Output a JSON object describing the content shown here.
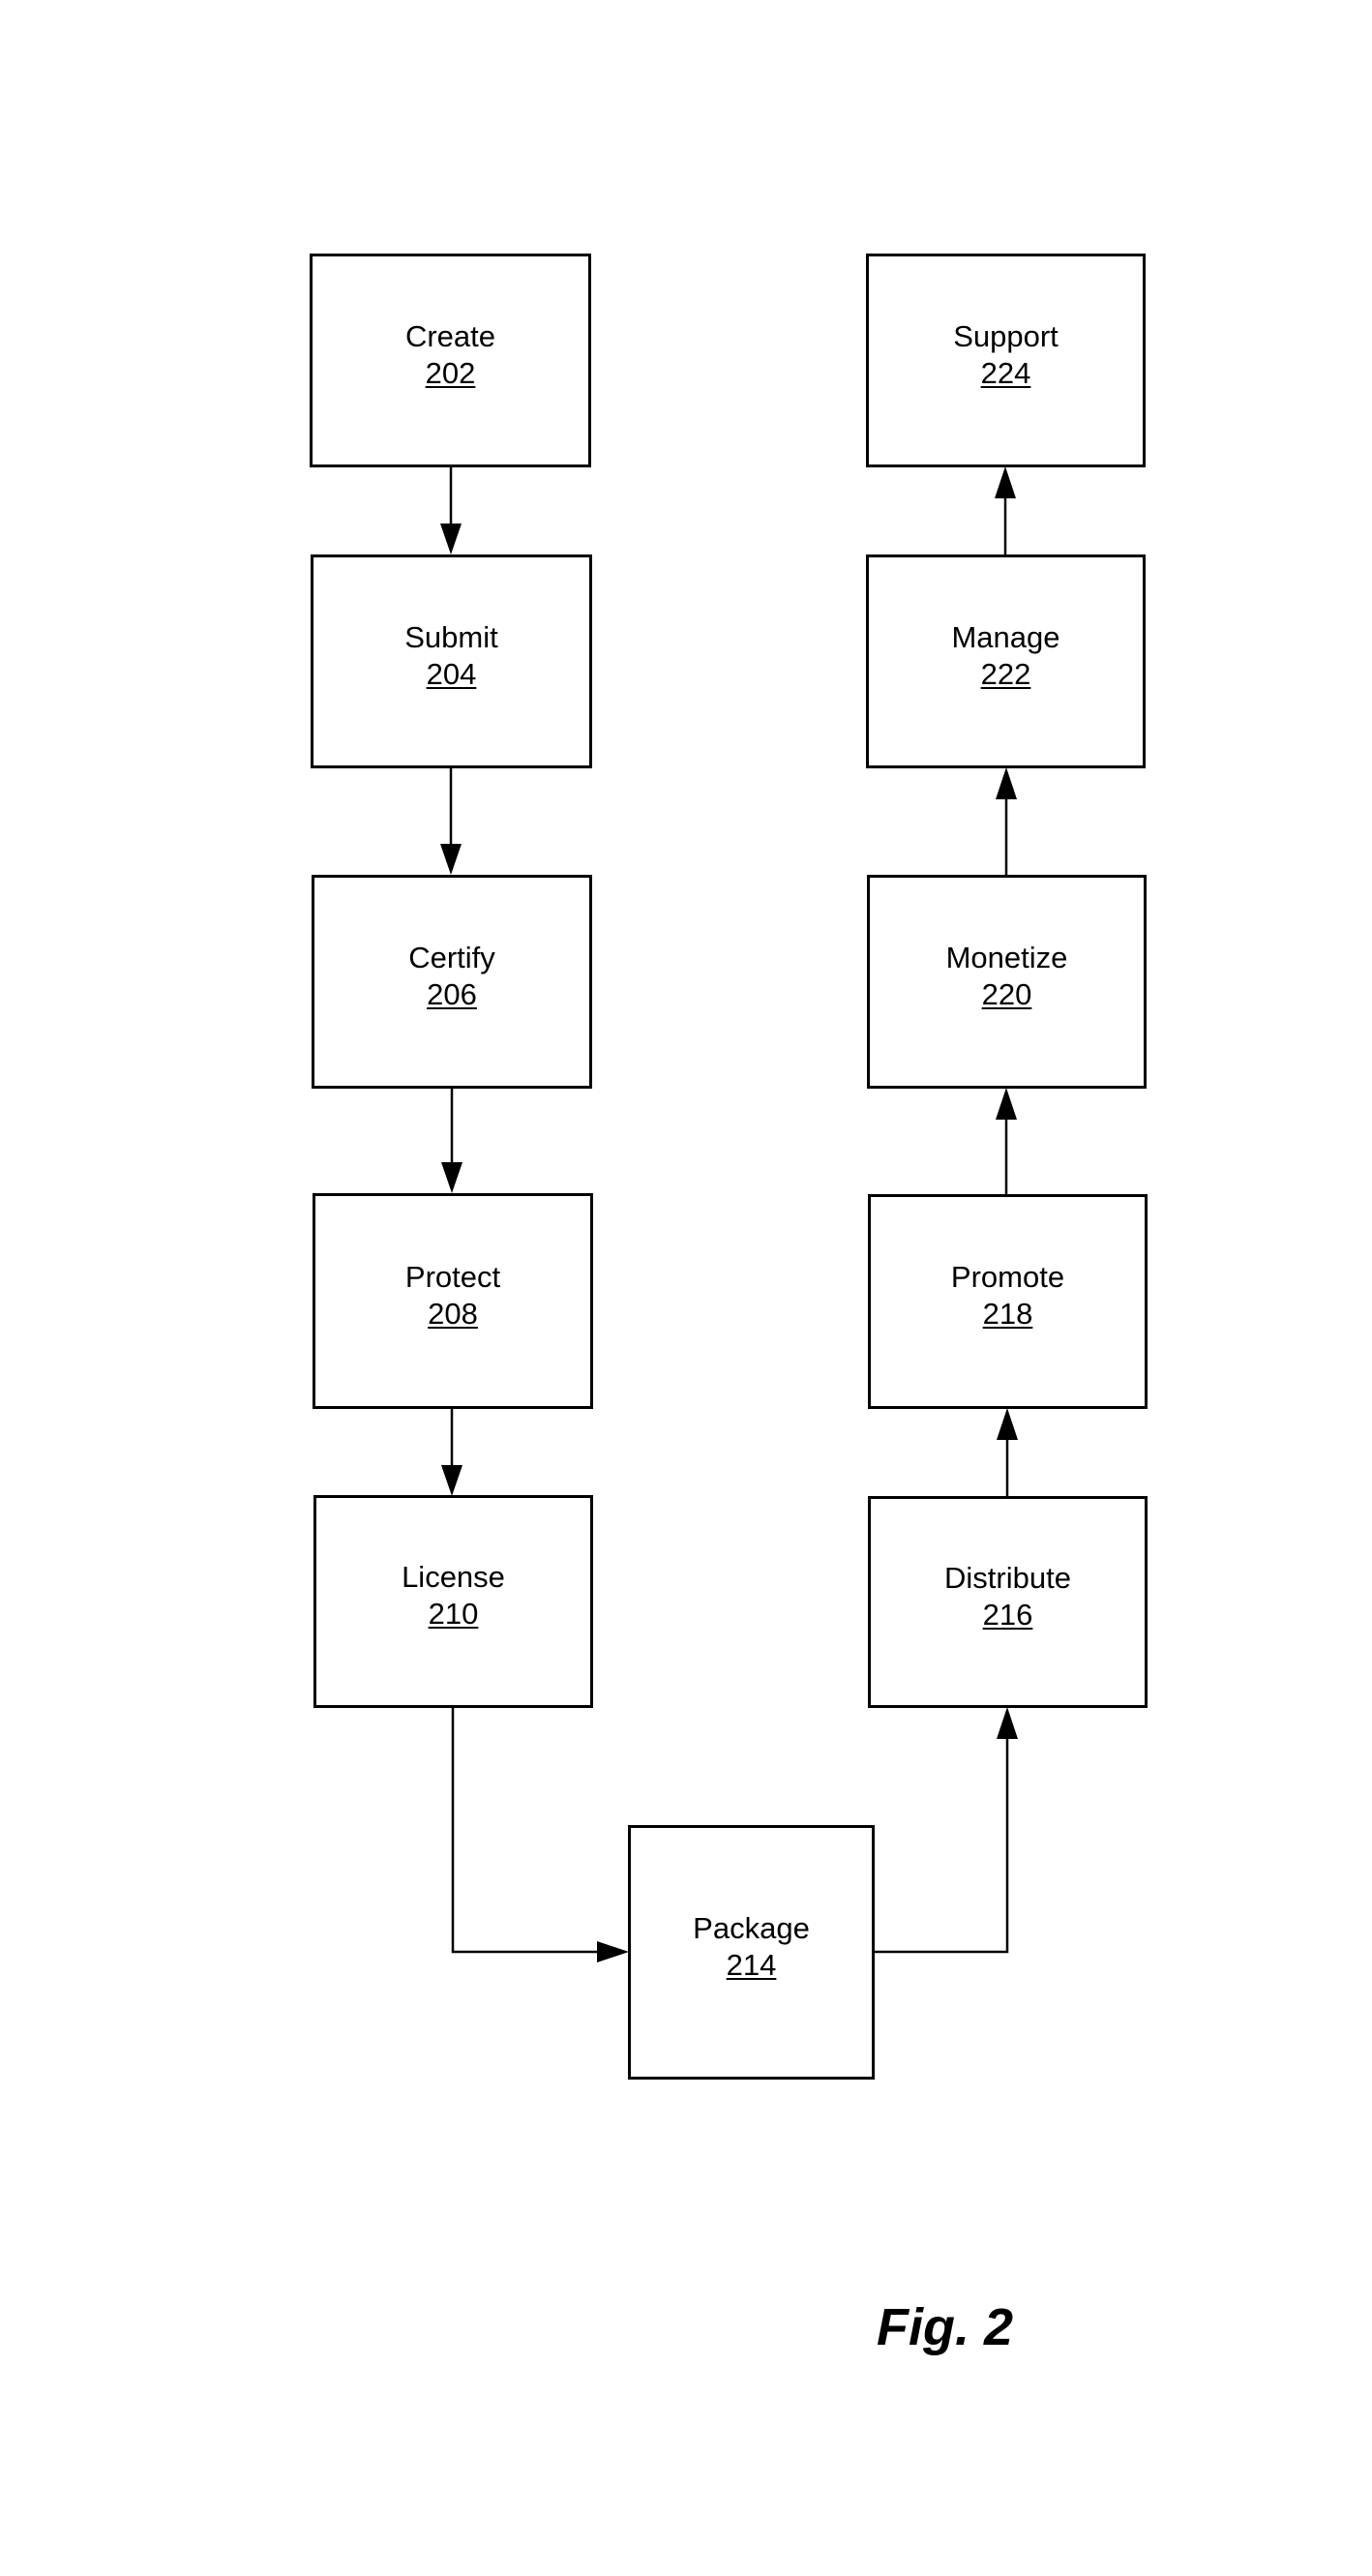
{
  "figure": {
    "label": "Fig. 2",
    "nodes": [
      {
        "id": "create",
        "label": "Create",
        "ref": "202"
      },
      {
        "id": "submit",
        "label": "Submit",
        "ref": "204"
      },
      {
        "id": "certify",
        "label": "Certify",
        "ref": "206"
      },
      {
        "id": "protect",
        "label": "Protect",
        "ref": "208"
      },
      {
        "id": "license",
        "label": "License",
        "ref": "210"
      },
      {
        "id": "package",
        "label": "Package",
        "ref": "214"
      },
      {
        "id": "distribute",
        "label": "Distribute",
        "ref": "216"
      },
      {
        "id": "promote",
        "label": "Promote",
        "ref": "218"
      },
      {
        "id": "monetize",
        "label": "Monetize",
        "ref": "220"
      },
      {
        "id": "manage",
        "label": "Manage",
        "ref": "222"
      },
      {
        "id": "support",
        "label": "Support",
        "ref": "224"
      }
    ],
    "edges": [
      {
        "from": "create",
        "to": "submit"
      },
      {
        "from": "submit",
        "to": "certify"
      },
      {
        "from": "certify",
        "to": "protect"
      },
      {
        "from": "protect",
        "to": "license"
      },
      {
        "from": "license",
        "to": "package"
      },
      {
        "from": "package",
        "to": "distribute"
      },
      {
        "from": "distribute",
        "to": "promote"
      },
      {
        "from": "promote",
        "to": "monetize"
      },
      {
        "from": "monetize",
        "to": "manage"
      },
      {
        "from": "manage",
        "to": "support"
      }
    ]
  }
}
